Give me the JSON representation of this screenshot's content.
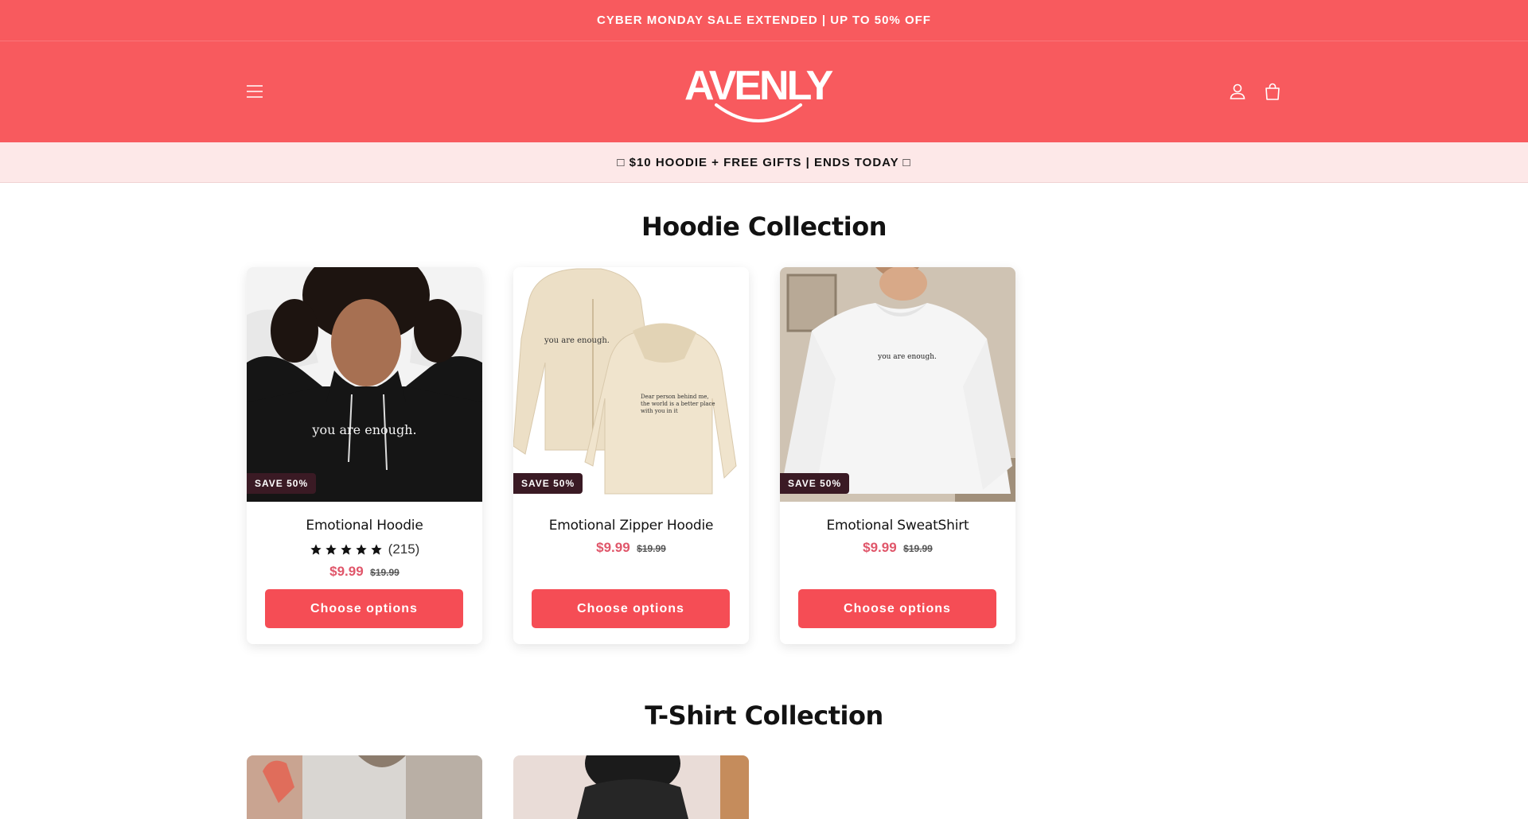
{
  "announcement": "CYBER MONDAY SALE EXTENDED | UP TO 50% OFF",
  "brand": {
    "logo_text": "AVENLY"
  },
  "promo_bar": "□ $10 HOODIE + FREE GIFTS | ENDS TODAY □",
  "icons": {
    "menu": "hamburger-icon",
    "account": "user-icon",
    "cart": "shopping-bag-icon",
    "star": "star-icon"
  },
  "colors": {
    "brand_red": "#f85a5e",
    "promo_bg": "#fde8e8",
    "badge": "#3a1a24",
    "price": "#e0566a",
    "button": "#f54d55"
  },
  "hoodie_section": {
    "title": "Hoodie Collection",
    "products": [
      {
        "name": "Emotional Hoodie",
        "badge": "SAVE 50%",
        "rating_count": "(215)",
        "rating_stars": 5,
        "price": "$9.99",
        "compare_price": "$19.99",
        "button": "Choose options",
        "image_text": "you are enough."
      },
      {
        "name": "Emotional Zipper Hoodie",
        "badge": "SAVE 50%",
        "price": "$9.99",
        "compare_price": "$19.99",
        "button": "Choose options",
        "image_text": "you are enough.",
        "image_back_text": "Dear person behind me, the world is a better place with you in it"
      },
      {
        "name": "Emotional SweatShirt",
        "badge": "SAVE 50%",
        "price": "$9.99",
        "compare_price": "$19.99",
        "button": "Choose options",
        "image_text": "you are enough."
      }
    ]
  },
  "tshirt_section": {
    "title": "T-Shirt Collection"
  }
}
